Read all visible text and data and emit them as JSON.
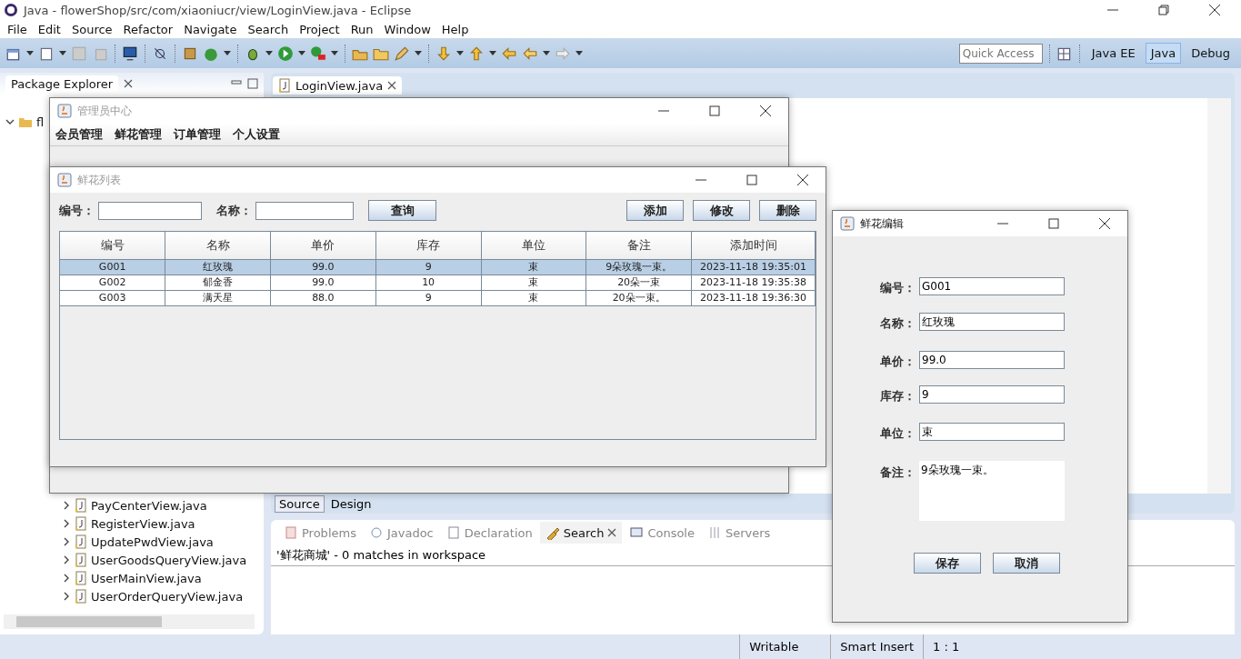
{
  "window": {
    "title": "Java - flowerShop/src/com/xiaoniucr/view/LoginView.java - Eclipse"
  },
  "menu": [
    "File",
    "Edit",
    "Source",
    "Refactor",
    "Navigate",
    "Search",
    "Project",
    "Run",
    "Window",
    "Help"
  ],
  "quick_access": {
    "placeholder": "Quick Access"
  },
  "perspectives": [
    {
      "label": "Java EE",
      "selected": false
    },
    {
      "label": "Java",
      "selected": true
    },
    {
      "label": "Debug",
      "selected": false
    }
  ],
  "package_explorer": {
    "title": "Package Explorer",
    "tree": [
      {
        "label": "fl",
        "expanded": true
      }
    ],
    "files": [
      {
        "label": "PayCenterView.java",
        "expanded": false
      },
      {
        "label": "RegisterView.java",
        "expanded": false
      },
      {
        "label": "UpdatePwdView.java",
        "expanded": false
      },
      {
        "label": "UserGoodsQueryView.java",
        "expanded": false
      },
      {
        "label": "UserMainView.java",
        "expanded": false
      },
      {
        "label": "UserOrderQueryView.java",
        "expanded": false
      }
    ]
  },
  "editor": {
    "tabs": [
      {
        "label": "LoginView.java",
        "selected": true
      }
    ],
    "bottom_tabs": [
      {
        "label": "Source",
        "selected": true
      },
      {
        "label": "Design",
        "selected": false
      }
    ]
  },
  "bottom_panel": {
    "tabs": [
      {
        "label": "Problems",
        "selected": false
      },
      {
        "label": "Javadoc",
        "selected": false
      },
      {
        "label": "Declaration",
        "selected": false
      },
      {
        "label": "Search",
        "selected": true
      },
      {
        "label": "Console",
        "selected": false
      },
      {
        "label": "Servers",
        "selected": false
      }
    ],
    "search_result": "'鲜花商城' - 0 matches in workspace"
  },
  "status_bar": [
    "Writable",
    "Smart Insert",
    "1 : 1"
  ],
  "admin_window": {
    "title": "管理员中心",
    "menu": [
      "会员管理",
      "鲜花管理",
      "订单管理",
      "个人设置"
    ]
  },
  "list_window": {
    "title": "鲜花列表",
    "filters": [
      {
        "label": "编号："
      },
      {
        "label": "名称："
      }
    ],
    "query_button": "查询",
    "buttons": [
      "添加",
      "修改",
      "删除"
    ],
    "columns": [
      "编号",
      "名称",
      "单价",
      "库存",
      "单位",
      "备注",
      "添加时间"
    ],
    "rows": [
      {
        "cells": [
          "G001",
          "红玫瑰",
          "99.0",
          "9",
          "束",
          "9朵玫瑰一束。",
          "2023-11-18 19:35:01"
        ],
        "selected": true
      },
      {
        "cells": [
          "G002",
          "郁金香",
          "99.0",
          "10",
          "束",
          "20朵一束",
          "2023-11-18 19:35:38"
        ],
        "selected": false
      },
      {
        "cells": [
          "G003",
          "满天星",
          "88.0",
          "9",
          "束",
          "20朵一束。",
          "2023-11-18 19:36:30"
        ],
        "selected": false
      }
    ]
  },
  "edit_window": {
    "title": "鲜花编辑",
    "fields": [
      {
        "label": "编号：",
        "value": "G001",
        "kind": "text"
      },
      {
        "label": "名称：",
        "value": "红玫瑰",
        "kind": "text"
      },
      {
        "label": "单价：",
        "value": "99.0",
        "kind": "text"
      },
      {
        "label": "库存：",
        "value": "9",
        "kind": "text"
      },
      {
        "label": "单位：",
        "value": "束",
        "kind": "text"
      },
      {
        "label": "备注：",
        "value": "9朵玫瑰一束。",
        "kind": "area"
      }
    ],
    "buttons": [
      "保存",
      "取消"
    ]
  }
}
